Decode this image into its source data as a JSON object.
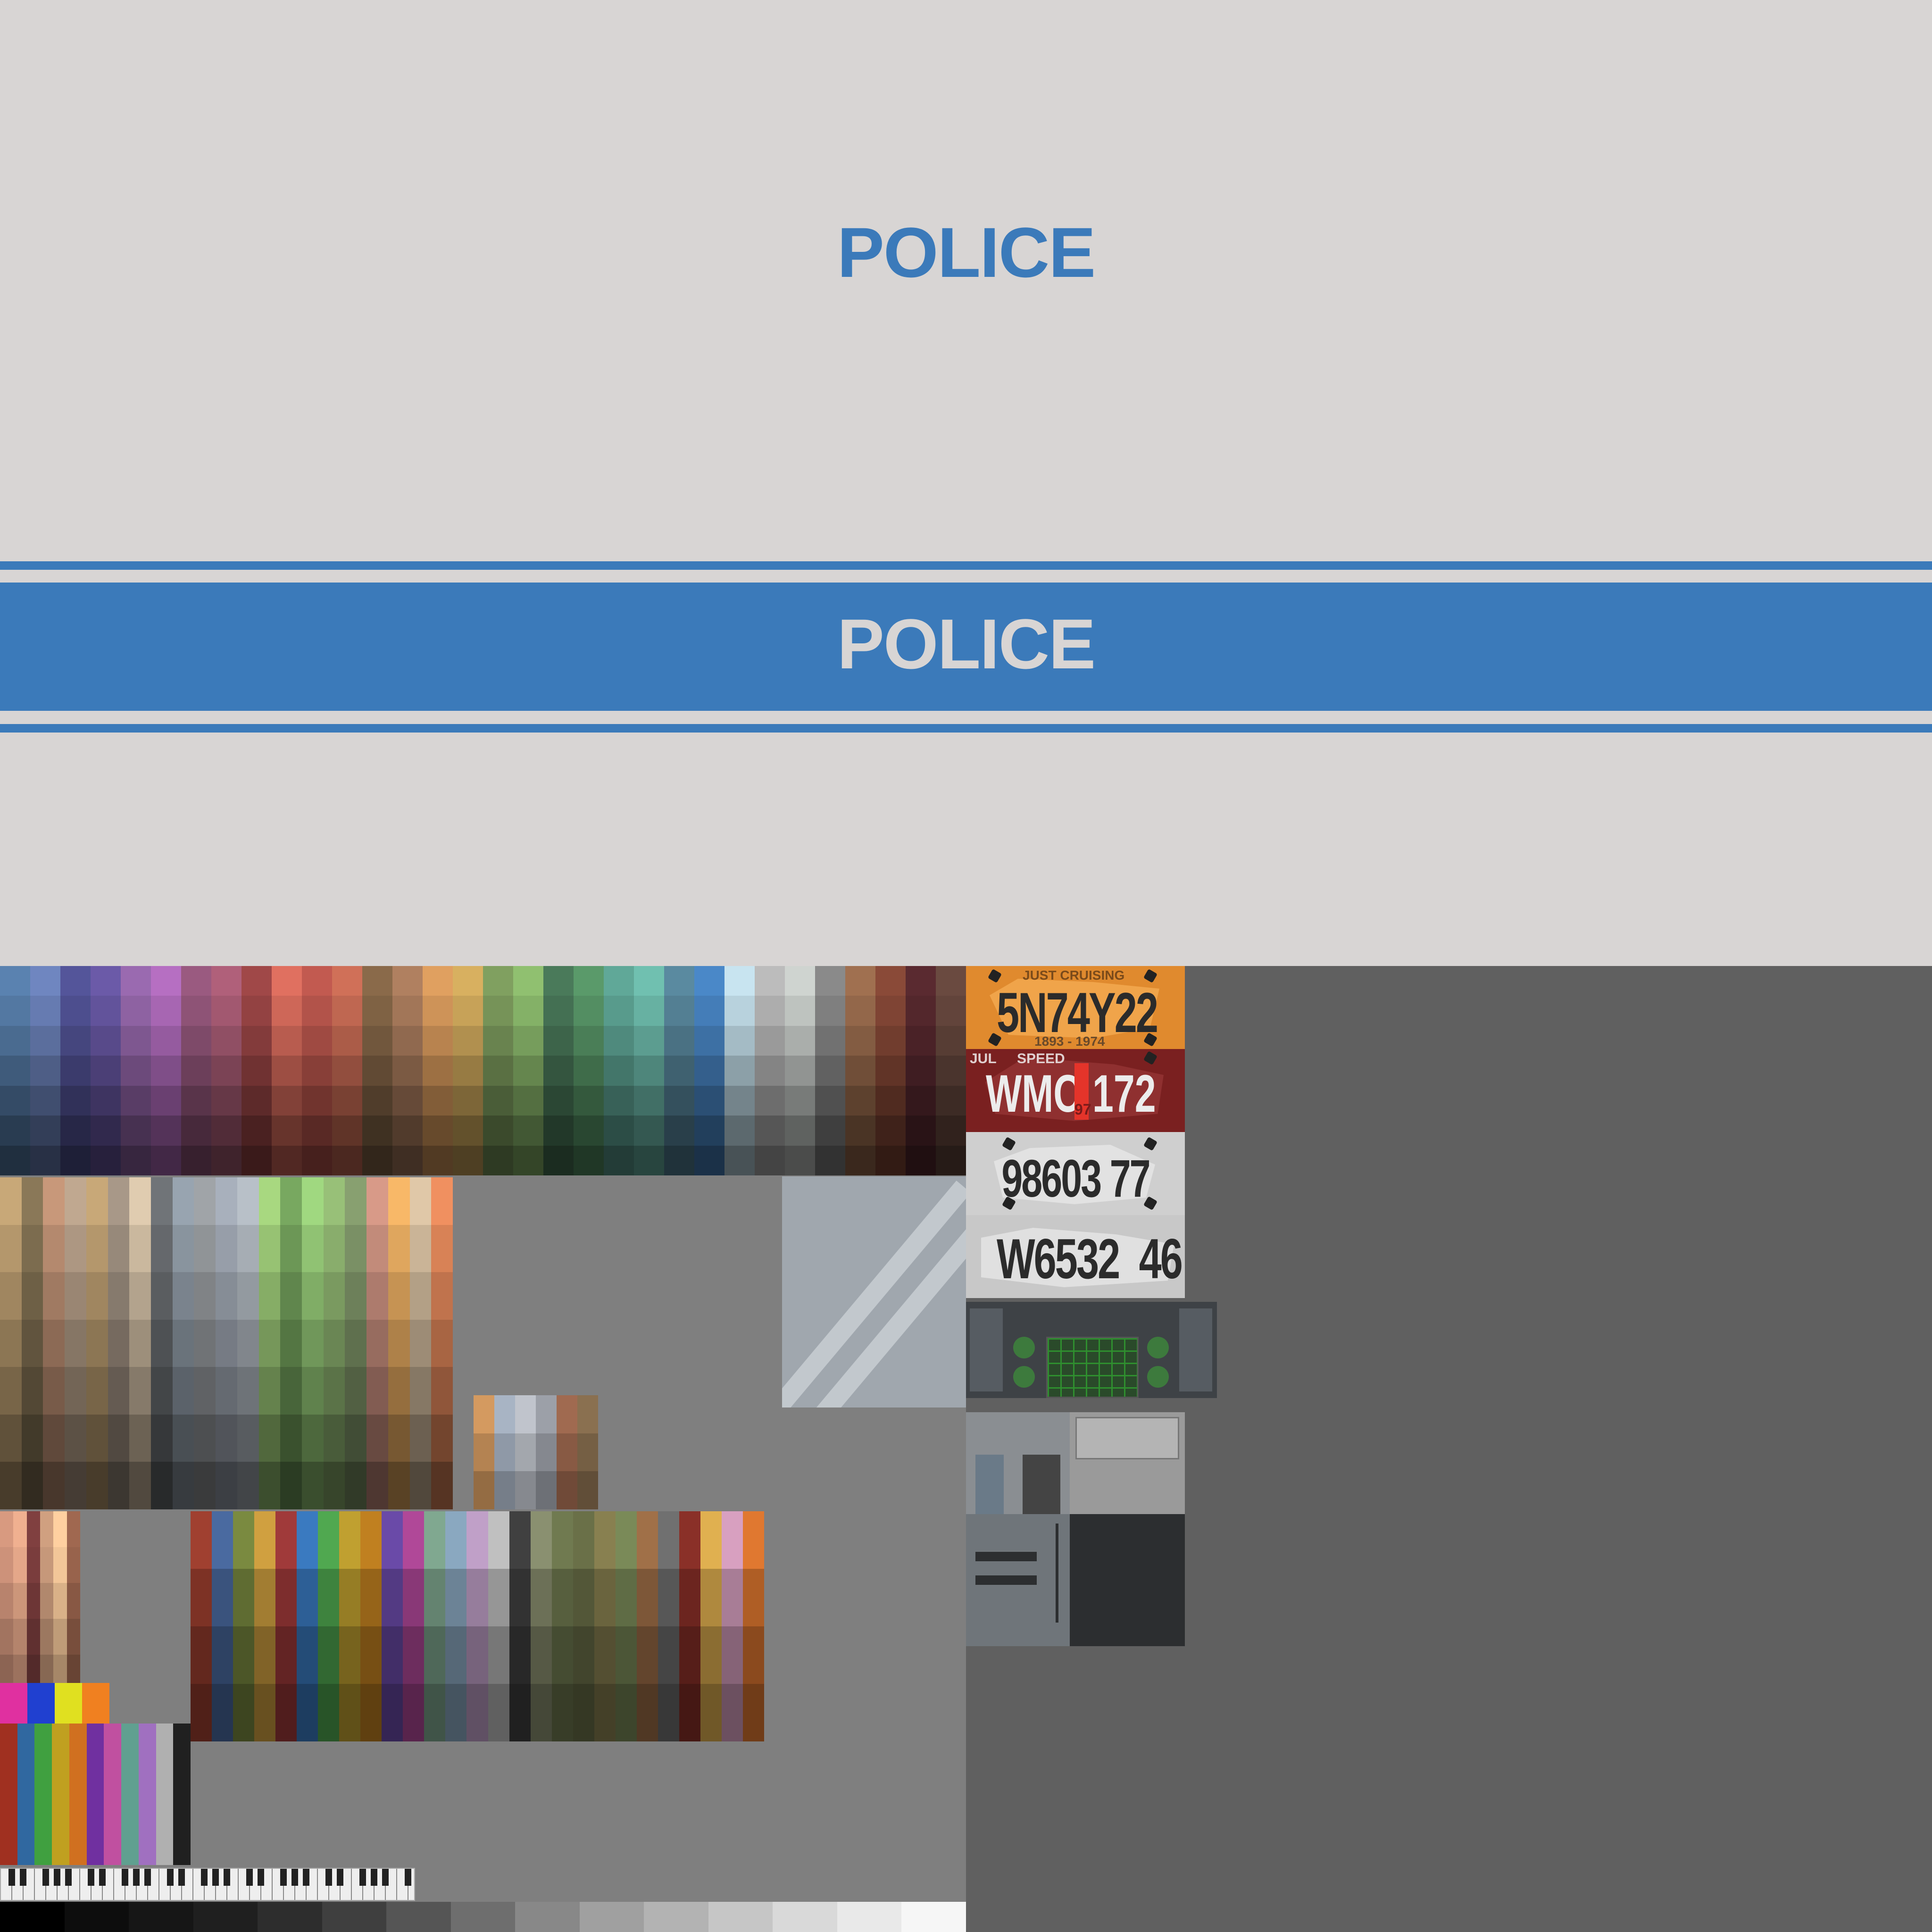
{
  "texture_sheet": {
    "title_top": "POLICE",
    "title_band": "POLICE",
    "colors": {
      "background": "#d8d5d4",
      "police_blue": "#3b7aba",
      "bottom_left_gray": "#7f7f7f",
      "bottom_right_gray": "#606060"
    }
  },
  "license_plates": [
    {
      "top_text": "JUST CRUISING",
      "number": "5N74Y22",
      "bottom_text": "1893 - 1974",
      "color": "#e08a2e"
    },
    {
      "top_left": "JUL",
      "top_mid": "SPEED",
      "number_left": "WMC",
      "tag": "97",
      "number_right": "172",
      "color": "#7a2020"
    },
    {
      "number": "98603 77",
      "color": "#cfcfcf"
    },
    {
      "number": "W6532  46",
      "color": "#c8c8c8"
    }
  ],
  "grayscale_ramp": [
    "#000000",
    "#0d0d0d",
    "#161616",
    "#1f1f1f",
    "#2d2d2d",
    "#3f3f3f",
    "#555555",
    "#6e6e6e",
    "#888888",
    "#a0a0a0",
    "#b3b3b3",
    "#c6c6c6",
    "#d9d9d9",
    "#e9e9e9",
    "#f6f6f6"
  ]
}
